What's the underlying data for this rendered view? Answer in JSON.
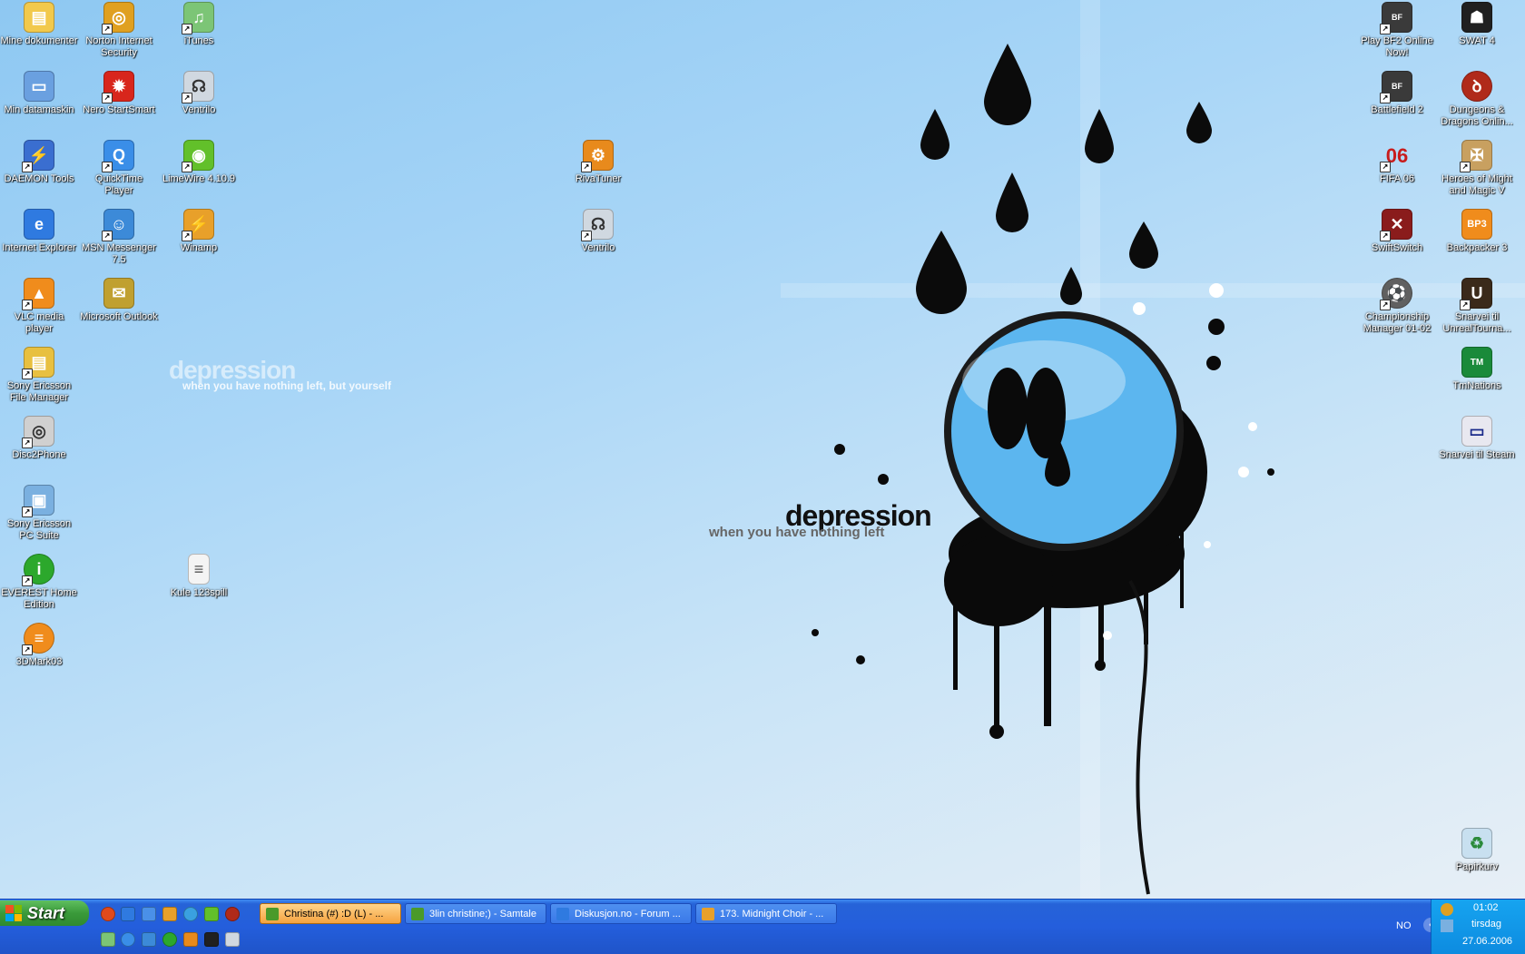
{
  "desktop": {
    "icons_left": [
      {
        "label": "Mine dokumenter",
        "icon": "folder-icon",
        "color": "#f2c94c"
      },
      {
        "label": "Norton Internet Security",
        "icon": "norton-icon",
        "color": "#e0a020"
      },
      {
        "label": "iTunes",
        "icon": "itunes-icon",
        "color": "#7cc576"
      },
      {
        "label": "Min datamaskin",
        "icon": "computer-icon",
        "color": "#6aa0e0"
      },
      {
        "label": "Nero StartSmart",
        "icon": "nero-icon",
        "color": "#d8261c"
      },
      {
        "label": "Ventrilo",
        "icon": "ventrilo-icon",
        "color": "#d0d8e0"
      },
      {
        "label": "DAEMON Tools",
        "icon": "daemon-icon",
        "color": "#3a6ed0"
      },
      {
        "label": "QuickTime Player",
        "icon": "quicktime-icon",
        "color": "#3a8ee8"
      },
      {
        "label": "LimeWire 4.10.9",
        "icon": "limewire-icon",
        "color": "#62c02a"
      },
      {
        "label": "Internet Explorer",
        "icon": "ie-icon",
        "color": "#2f7ae0"
      },
      {
        "label": "MSN Messenger 7.5",
        "icon": "msn-icon",
        "color": "#3c8ad8"
      },
      {
        "label": "Winamp",
        "icon": "winamp-icon",
        "color": "#e8a02a"
      },
      {
        "label": "VLC media player",
        "icon": "vlc-icon",
        "color": "#f08c1c"
      },
      {
        "label": "Microsoft Outlook",
        "icon": "outlook-icon",
        "color": "#c0a030"
      },
      {
        "label": "Sony Ericsson File Manager",
        "icon": "file-manager-icon",
        "color": "#e8c040"
      },
      {
        "label": "Disc2Phone",
        "icon": "disc2phone-icon",
        "color": "#d0d0d0"
      },
      {
        "label": "Sony Ericsson PC Suite",
        "icon": "pc-suite-icon",
        "color": "#7ab0e0"
      },
      {
        "label": "EVEREST Home Edition",
        "icon": "everest-icon",
        "color": "#2ca82c"
      },
      {
        "label": "Kule 123spill",
        "icon": "text-file-icon",
        "color": "#f4f4f4"
      },
      {
        "label": "3DMark03",
        "icon": "3dmark-icon",
        "color": "#f08c1c"
      }
    ],
    "icons_middle": [
      {
        "label": "RivaTuner",
        "icon": "rivatuner-icon",
        "color": "#e88a1c"
      },
      {
        "label": "Ventrilo",
        "icon": "ventrilo-icon",
        "color": "#d0d8e0"
      }
    ],
    "icons_right": [
      {
        "label": "Play BF2 Online Now!",
        "icon": "battlefield-icon",
        "color": "#3a3a3a"
      },
      {
        "label": "SWAT 4",
        "icon": "swat-icon",
        "color": "#202020"
      },
      {
        "label": "Battlefield 2",
        "icon": "battlefield-icon",
        "color": "#3a3a3a"
      },
      {
        "label": "Dungeons & Dragons Onlin...",
        "icon": "ddo-icon",
        "color": "#b02a1a"
      },
      {
        "label": "FIFA 06",
        "icon": "fifa-icon",
        "color": "#c81c1c"
      },
      {
        "label": "Heroes of Might and Magic V",
        "icon": "heroes-icon",
        "color": "#c8a060"
      },
      {
        "label": "SwiftSwitch",
        "icon": "swiftswitch-icon",
        "color": "#8a1c1c"
      },
      {
        "label": "Backpacker 3",
        "icon": "backpacker-icon",
        "color": "#f08c1c"
      },
      {
        "label": "Championship Manager 01-02",
        "icon": "soccer-icon",
        "color": "#606060"
      },
      {
        "label": "Snarvei til UnrealTourna...",
        "icon": "unreal-icon",
        "color": "#3a2a1a"
      },
      {
        "label": "TmNations",
        "icon": "tmnations-icon",
        "color": "#1a8a3a"
      },
      {
        "label": "Snarvei til Steam",
        "icon": "steam-icon",
        "color": "#e8e8f0"
      },
      {
        "label": "Papirkurv",
        "icon": "recycle-bin-icon",
        "color": "#c8e0f0"
      }
    ],
    "wallpaper": {
      "title_small": "depression",
      "subtitle_small": "when you have nothing left, but yourself",
      "title_big": "depression",
      "subtitle_big": "when you have nothing left"
    }
  },
  "taskbar": {
    "start_label": "Start",
    "quick_launch": [
      {
        "icon": "firefox-icon",
        "color": "#e04a1c"
      },
      {
        "icon": "ie-icon",
        "color": "#2f7ae0"
      },
      {
        "icon": "ie-icon",
        "color": "#4a90e8"
      },
      {
        "icon": "winamp-icon",
        "color": "#e8a02a"
      },
      {
        "icon": "media-player-icon",
        "color": "#3aa0e0"
      },
      {
        "icon": "limewire-icon",
        "color": "#62c02a"
      },
      {
        "icon": "ddo-icon",
        "color": "#b02a1a"
      },
      {
        "icon": "itunes-icon",
        "color": "#7cc576"
      },
      {
        "icon": "quicktime-icon",
        "color": "#3a8ee8"
      },
      {
        "icon": "msn-icon",
        "color": "#3c8ad8"
      },
      {
        "icon": "everest-icon",
        "color": "#2ca82c"
      },
      {
        "icon": "rivatuner-icon",
        "color": "#e88a1c"
      },
      {
        "icon": "swat-icon",
        "color": "#202020"
      },
      {
        "icon": "ventrilo-icon",
        "color": "#d0d8e0"
      }
    ],
    "tasks": [
      {
        "label": "Christina (#) :D (L) - ...",
        "icon": "msn-chat-icon",
        "color": "#4a9a2a",
        "active": true
      },
      {
        "label": "3lin christine;) - Samtale",
        "icon": "msn-chat-icon",
        "color": "#4a9a2a",
        "active": false
      },
      {
        "label": "Diskusjon.no - Forum ...",
        "icon": "ie-icon",
        "color": "#2f7ae0",
        "active": false
      },
      {
        "label": "173. Midnight Choir - ...",
        "icon": "winamp-icon",
        "color": "#e8a02a",
        "active": false
      }
    ],
    "language": "NO",
    "clock": {
      "time": "01:02",
      "day": "tirsdag",
      "date": "27.06.2006"
    }
  }
}
